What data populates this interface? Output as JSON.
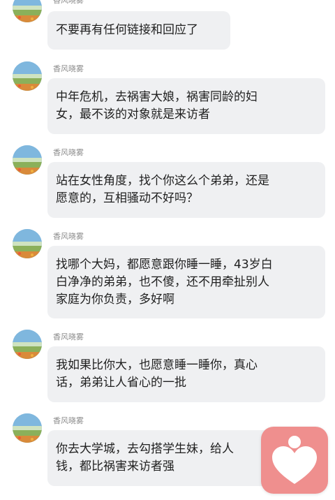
{
  "chat": {
    "messages": [
      {
        "sender": "香风晓雾",
        "lines": [
          "不要再有任何链接和回应了"
        ]
      },
      {
        "sender": "香风晓雾",
        "lines": [
          "中年危机，去祸害大娘，祸害同龄的妇",
          "女，最不该的对象就是来访者"
        ]
      },
      {
        "sender": "香风晓雾",
        "lines": [
          "站在女性角度，找个你这么个弟弟，还是",
          "愿意的，互相骚动不好吗？"
        ]
      },
      {
        "sender": "香风晓雾",
        "lines": [
          "找哪个大妈，都愿意跟你睡一睡，43岁白",
          "白净净的弟弟，也不傻，还不用牵扯别人",
          "家庭为你负责，多好啊"
        ]
      },
      {
        "sender": "香风晓雾",
        "lines": [
          "我如果比你大，也愿意睡一睡你，真心",
          "话，弟弟让人省心的一批"
        ]
      },
      {
        "sender": "香风晓雾",
        "lines": [
          "你去大学城，去勾搭学生妹，给人",
          "钱，都比祸害来访者强"
        ]
      }
    ]
  },
  "floating_button": {
    "icon": "heart-person-icon",
    "color": "#ef8f8e"
  }
}
